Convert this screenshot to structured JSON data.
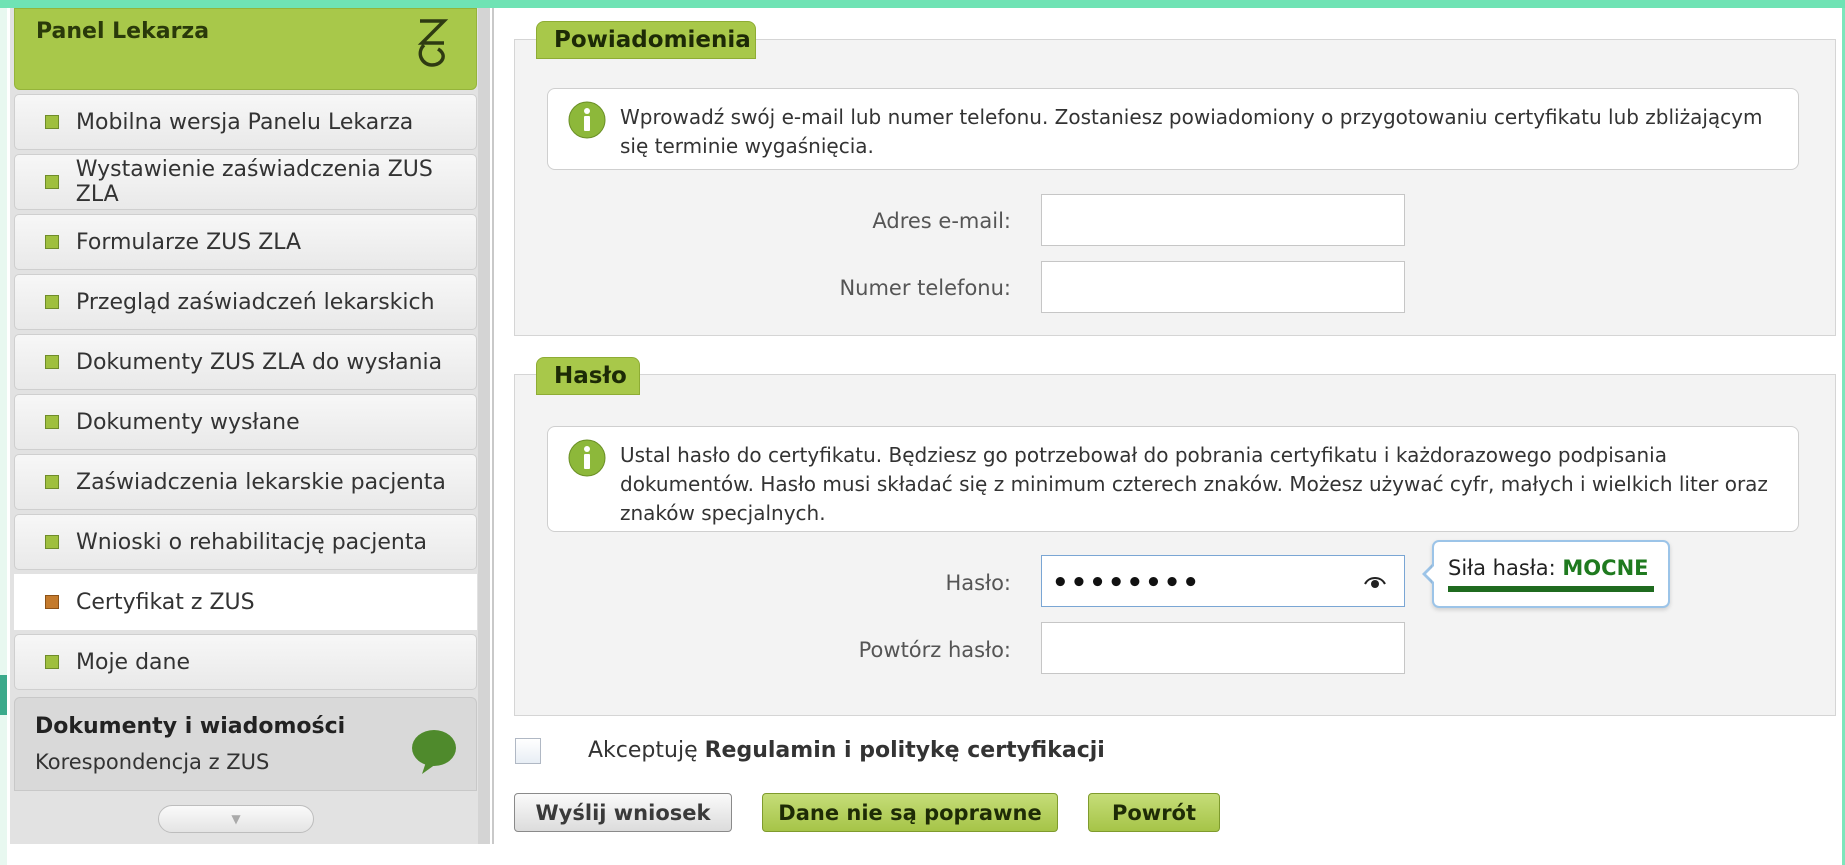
{
  "sidebar": {
    "panel_title": "Panel Lekarza",
    "items": [
      {
        "label": "Mobilna wersja Panelu Lekarza"
      },
      {
        "label": "Wystawienie zaświadczenia ZUS ZLA"
      },
      {
        "label": "Formularze ZUS ZLA"
      },
      {
        "label": "Przegląd zaświadczeń lekarskich"
      },
      {
        "label": "Dokumenty ZUS ZLA do wysłania"
      },
      {
        "label": "Dokumenty wysłane"
      },
      {
        "label": "Zaświadczenia lekarskie pacjenta"
      },
      {
        "label": "Wnioski o rehabilitację pacjenta"
      },
      {
        "label": "Certyfikat z ZUS",
        "active": true
      },
      {
        "label": "Moje dane"
      }
    ],
    "docs_title": "Dokumenty i wiadomości",
    "docs_sub": "Korespondencja z ZUS",
    "icons": {
      "logo": "zus-logo-icon",
      "chat": "speech-bubble-icon",
      "scroll": "chevron-down-icon"
    }
  },
  "notifications": {
    "legend": "Powiadomienia",
    "info": "Wprowadź swój e-mail lub numer telefonu. Zostaniesz powiadomiony o przygotowaniu certyfikatu lub zbliżającym się terminie wygaśnięcia.",
    "email_label": "Adres e-mail:",
    "email_value": "",
    "phone_label": "Numer telefonu:",
    "phone_value": ""
  },
  "password": {
    "legend": "Hasło",
    "info": "Ustal hasło do certyfikatu. Będziesz go potrzebował do pobrania certyfikatu i każdorazowego podpisania dokumentów. Hasło musi składać się z minimum czterech znaków. Możesz używać cyfr, małych i wielkich liter oraz znaków specjalnych.",
    "password_label": "Hasło:",
    "password_masked": "••••••••",
    "repeat_label": "Powtórz hasło:",
    "repeat_value": "",
    "strength_label": "Siła hasła:",
    "strength_value": "MOCNE"
  },
  "consent": {
    "prefix": "Akceptuję",
    "link": "Regulamin i politykę certyfikacji",
    "checked": false
  },
  "buttons": {
    "send": "Wyślij wniosek",
    "wrong_data": "Dane nie są poprawne",
    "back": "Powrót"
  },
  "colors": {
    "accent_green": "#a8c84a",
    "strength_green": "#1f7a1f",
    "top_bar": "#6fe3b4"
  }
}
